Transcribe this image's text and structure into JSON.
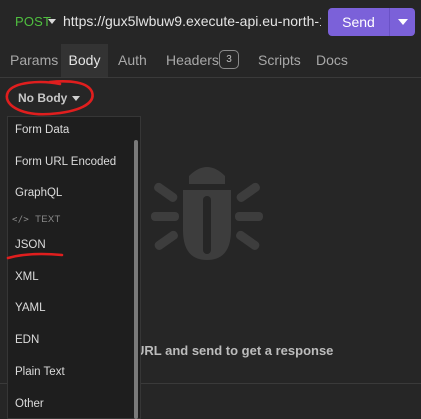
{
  "request": {
    "method": "POST",
    "url": "https://gux5lwbuw9.execute-api.eu-north-1.",
    "send_label": "Send"
  },
  "tabs": [
    {
      "label": "Params"
    },
    {
      "label": "Body"
    },
    {
      "label": "Auth"
    },
    {
      "label": "Headers"
    },
    {
      "label": "Scripts"
    },
    {
      "label": "Docs"
    }
  ],
  "headers_count": "3",
  "body": {
    "type_label": "No Body"
  },
  "menu": {
    "items_top": [
      "Form Data",
      "Form URL Encoded",
      "GraphQL"
    ],
    "section_label": "TEXT",
    "section_icon": "code-icon",
    "items_text": [
      "JSON",
      "XML",
      "YAML",
      "EDN",
      "Plain Text",
      "Other"
    ]
  },
  "response": {
    "empty_hint": "URL and send to get a response"
  },
  "colors": {
    "method": "#4fbf3f",
    "send_button": "#7b61d9",
    "annotation": "#e01e1e"
  }
}
